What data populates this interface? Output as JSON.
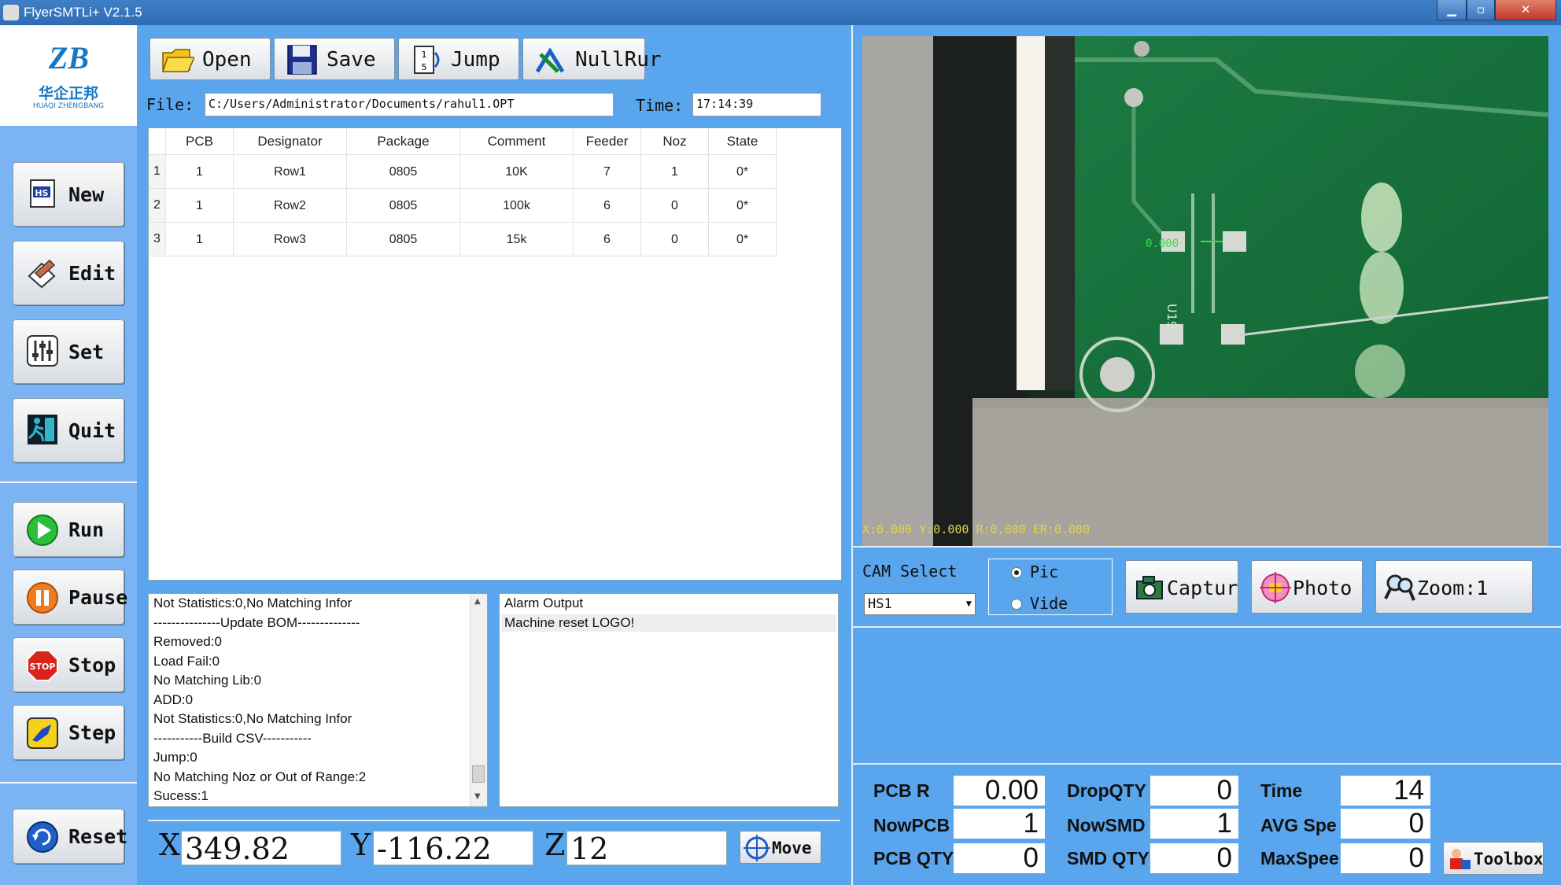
{
  "window": {
    "title": "FlyerSMTLi+ V2.1.5",
    "min": "▁",
    "max": "▫",
    "close": "✕"
  },
  "logo": {
    "cn": "华企正邦",
    "en": "HUAQI ZHENGBANG"
  },
  "sidebar": {
    "new": "New",
    "edit": "Edit",
    "set": "Set",
    "quit": "Quit",
    "run": "Run",
    "pause": "Pause",
    "stop": "Stop",
    "step": "Step",
    "reset": "Reset",
    "stop_icon_text": "STOP"
  },
  "toolbar": {
    "open": "Open",
    "save": "Save",
    "jump": "Jump",
    "nullrun": "NullRur"
  },
  "file": {
    "label": "File:",
    "value": "C:/Users/Administrator/Documents/rahul1.OPT",
    "time_label": "Time:",
    "time_value": "17:14:39"
  },
  "grid": {
    "headers": [
      "PCB",
      "Designator",
      "Package",
      "Comment",
      "Feeder",
      "Noz",
      "State"
    ],
    "rows": [
      {
        "num": "1",
        "cells": [
          "1",
          "Row1",
          "0805",
          "10K",
          "7",
          "1",
          "0*"
        ]
      },
      {
        "num": "2",
        "cells": [
          "1",
          "Row2",
          "0805",
          "100k",
          "6",
          "0",
          "0*"
        ]
      },
      {
        "num": "3",
        "cells": [
          "1",
          "Row3",
          "0805",
          "15k",
          "6",
          "0",
          "0*"
        ]
      }
    ]
  },
  "log": [
    "Not Statistics:0,No Matching Infor",
    "---------------Update BOM--------------",
    "Removed:0",
    "Load Fail:0",
    "No Matching Lib:0",
    "ADD:0",
    "Not Statistics:0,No Matching Infor",
    "-----------Build CSV-----------",
    "Jump:0",
    "No Matching Noz or Out of Range:2",
    "Sucess:1"
  ],
  "alarm": {
    "title": "Alarm Output",
    "lines": [
      "Machine reset LOGO!"
    ]
  },
  "coords": {
    "x_label": "X",
    "x": "349.82",
    "y_label": "Y",
    "y": "-116.22",
    "z_label": "Z",
    "z": "12",
    "move": "Move"
  },
  "camera": {
    "readout": "X:0.000 Y:0.000 R:0.000 ER:0.000",
    "marker": "0.000",
    "pcb_label": "U19"
  },
  "cam": {
    "label": "CAM Select",
    "selected": "HS1",
    "pic": "Pic",
    "vide": "Vide",
    "capture": "Captur",
    "photo": "Photo",
    "zoom": "Zoom:1"
  },
  "stats": {
    "pcbr_label": "PCB R",
    "pcbr": "0.00",
    "droppqty_label": "DropQTY",
    "dropqty": "0",
    "time_label": "Time",
    "time": "14",
    "nowpcb_label": "NowPCB",
    "nowpcb": "1",
    "nowsmd_label": "NowSMD",
    "nowsmd": "1",
    "avgspe_label": "AVG Spe",
    "avgspe": "0",
    "pcbqty_label": "PCB QTY",
    "pcbqty": "0",
    "smdqty_label": "SMD QTY",
    "smdqty": "0",
    "maxspee_label": "MaxSpee",
    "maxspee": "0",
    "toolbox": "Toolbox"
  }
}
